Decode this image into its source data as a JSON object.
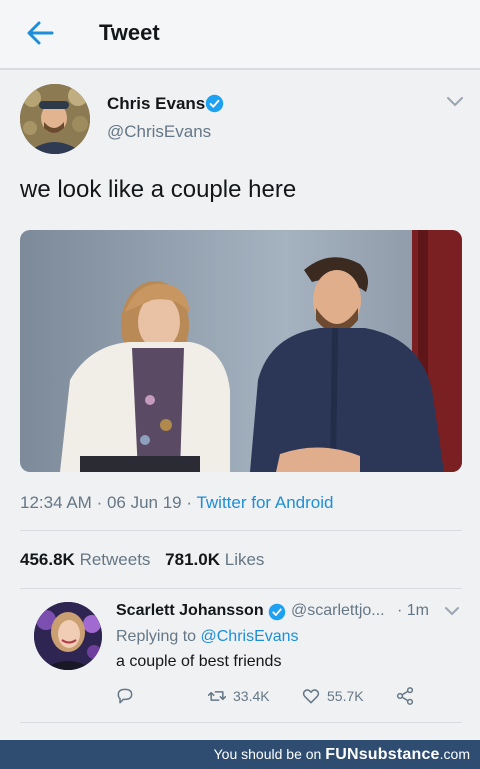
{
  "header": {
    "title": "Tweet"
  },
  "tweet": {
    "author_name": "Chris Evans",
    "handle": "@ChrisEvans",
    "text": "we look like a couple here",
    "time": "12:34 AM",
    "date": "06 Jun 19",
    "source": "Twitter for Android",
    "retweets_count": "456.8K",
    "retweets_label": "Retweets",
    "likes_count": "781.0K",
    "likes_label": "Likes"
  },
  "reply": {
    "author_name": "Scarlett Johansson",
    "handle": "@scarlettjo...",
    "time": "1m",
    "replying_prefix": "Replying to",
    "replying_to": "@ChrisEvans",
    "text": "a couple of best friends",
    "retweets": "33.4K",
    "likes": "55.7K"
  },
  "footer": {
    "prefix": "You should be on",
    "brand": "FUNsubstance",
    "suffix": ".com"
  },
  "colors": {
    "accent": "#1d8fd9",
    "secondary_text": "#657786",
    "verified": "#1da1f2"
  },
  "icons": [
    "back-arrow-icon",
    "verified-icon",
    "chevron-down-icon",
    "reply-icon",
    "retweet-icon",
    "like-icon",
    "share-icon"
  ]
}
